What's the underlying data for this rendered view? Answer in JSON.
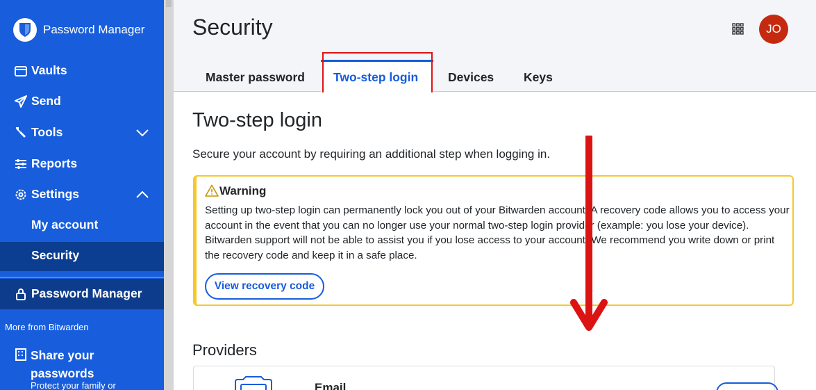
{
  "sidebar": {
    "brand": "Password Manager",
    "items": [
      {
        "label": "Vaults",
        "icon": "vault-icon"
      },
      {
        "label": "Send",
        "icon": "send-icon"
      },
      {
        "label": "Tools",
        "icon": "tools-icon"
      },
      {
        "label": "Reports",
        "icon": "sliders-icon"
      },
      {
        "label": "Settings",
        "icon": "gear-icon"
      },
      {
        "label": "My account"
      },
      {
        "label": "Security"
      }
    ],
    "product_switcher": "Password Manager",
    "more_from": "More from Bitwarden",
    "share_title": "Share your passwords",
    "share_subtitle": "Protect your family or"
  },
  "header": {
    "title": "Security",
    "avatar_initials": "JO"
  },
  "tabs": [
    "Master password",
    "Two-step login",
    "Devices",
    "Keys"
  ],
  "main": {
    "heading": "Two-step login",
    "description": "Secure your account by requiring an additional step when logging in.",
    "warning": {
      "title": "Warning",
      "text": "Setting up two-step login can permanently lock you out of your Bitwarden account. A recovery code allows you to access your account in the event that you can no longer use your normal two-step login provider (example: you lose your device). Bitwarden support will not be able to assist you if you lose access to your account. We recommend you write down or print the recovery code and keep it in a safe place.",
      "button": "View recovery code"
    },
    "providers_heading": "Providers",
    "provider_name": "Email"
  },
  "colors": {
    "brand_blue": "#175ddc",
    "sidebar_active": "#0b3d91",
    "warning_border": "#f5c82c",
    "avatar": "#c52a10",
    "annotation_red": "#dc1313"
  }
}
